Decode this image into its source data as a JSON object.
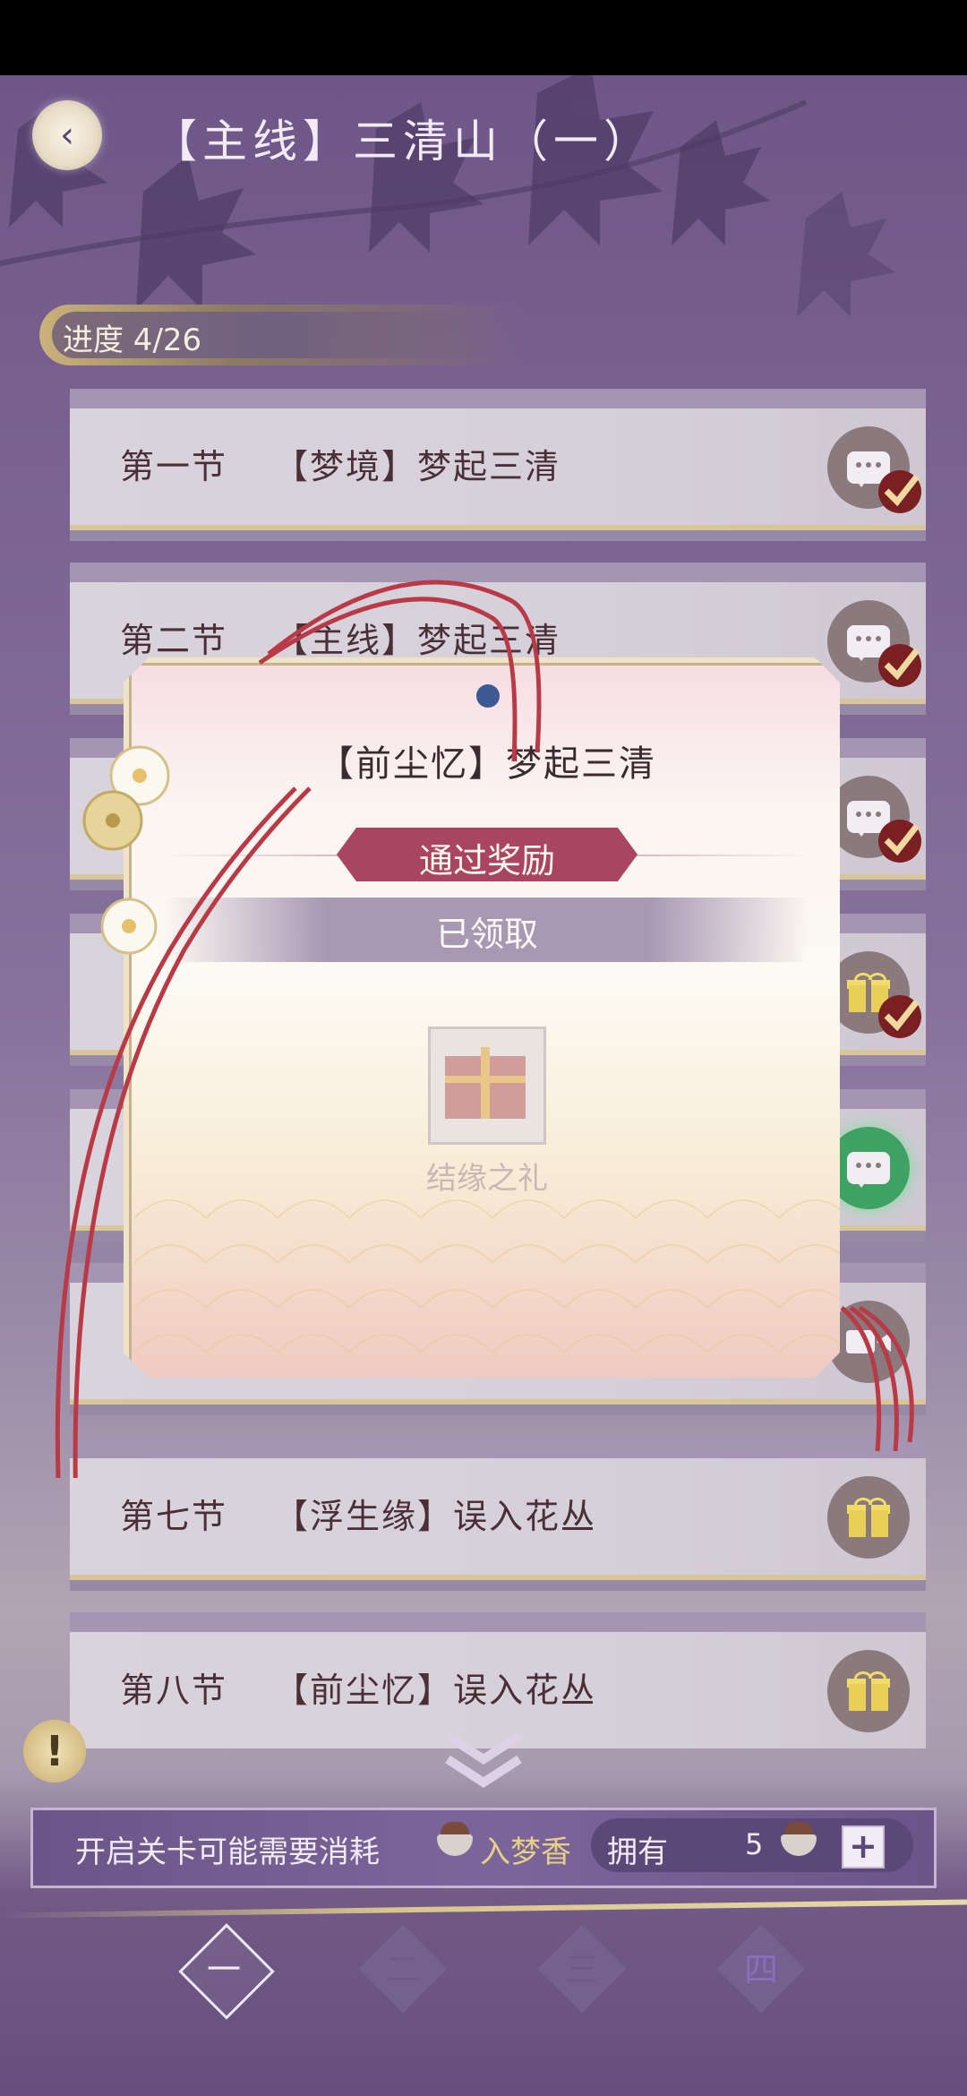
{
  "header": {
    "title": "【主线】三清山（一）",
    "back_icon": "chevron-left-icon"
  },
  "progress": {
    "label": "进度 4/26"
  },
  "sections": [
    {
      "label": "第一节",
      "title": "【梦境】梦起三清",
      "action": "chat",
      "done": true
    },
    {
      "label": "第二节",
      "title": "【主线】梦起三清",
      "action": "chat",
      "done": true
    },
    {
      "label": "",
      "title": "",
      "action": "chat",
      "done": true
    },
    {
      "label": "",
      "title": "",
      "action": "gift",
      "done": true
    },
    {
      "label": "",
      "title": "",
      "action": "chat-active",
      "done": false
    },
    {
      "label": "",
      "title": "",
      "action": "video",
      "done": false
    },
    {
      "label": "第七节",
      "title": "【浮生缘】误入花丛",
      "action": "gift",
      "done": false
    },
    {
      "label": "第八节",
      "title": "【前尘忆】误入花丛",
      "action": "gift",
      "done": false
    }
  ],
  "modal": {
    "title": "【前尘忆】梦起三清",
    "reward_label": "通过奖励",
    "claimed_label": "已领取",
    "item_name": "结缘之礼"
  },
  "footer": {
    "notice": "开启关卡可能需要消耗",
    "currency_name": "入梦香",
    "own_label": "拥有",
    "own_count": "5",
    "plus": "+"
  },
  "tabs": [
    "一",
    "二",
    "三",
    "四"
  ],
  "colors": {
    "accent": "#a9455f",
    "gold": "#e7cf8a",
    "active_tab": "#8a6cc0"
  }
}
